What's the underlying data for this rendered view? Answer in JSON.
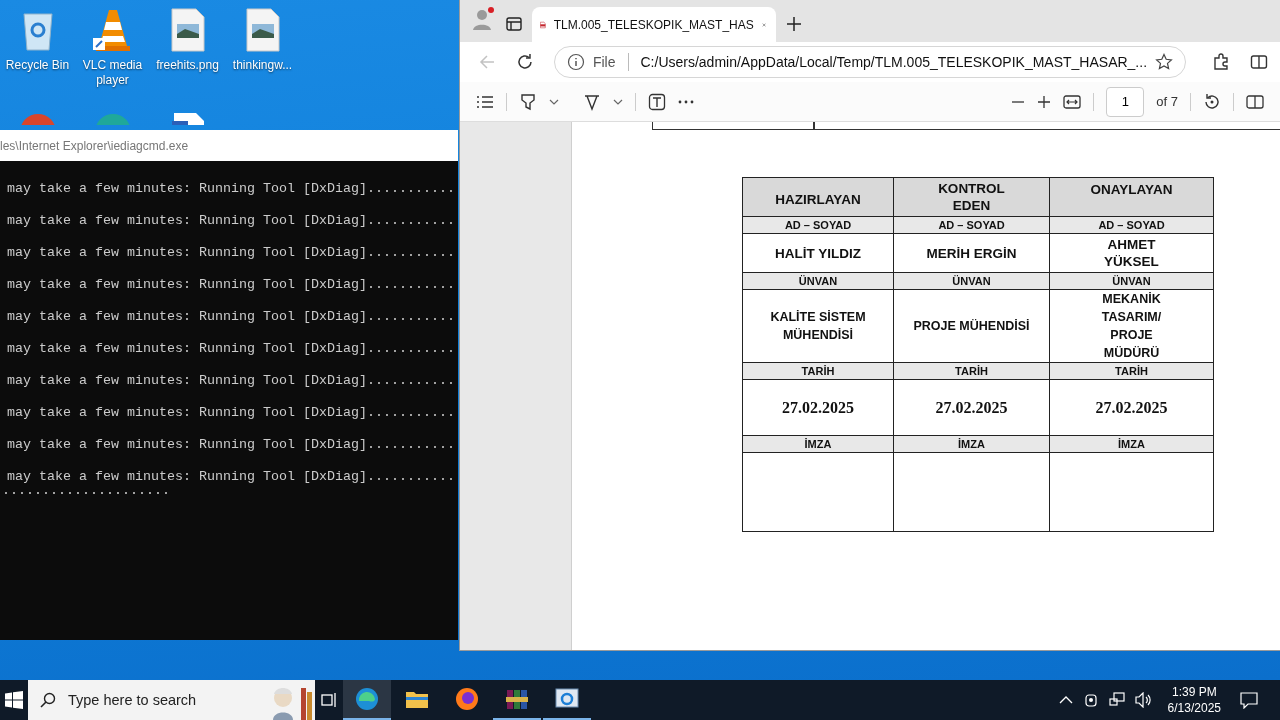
{
  "desktop_icons": [
    {
      "label": "Recycle Bin",
      "kind": "recycle"
    },
    {
      "label": "VLC media player",
      "kind": "vlc"
    },
    {
      "label": "freehits.png",
      "kind": "image"
    },
    {
      "label": "thinkingw...",
      "kind": "image"
    }
  ],
  "desktop_icons_row2": [
    {
      "kind": "browser-red"
    },
    {
      "kind": "browser-teal"
    },
    {
      "kind": "document"
    }
  ],
  "console": {
    "title": "les\\Internet Explorer\\iediagcmd.exe",
    "lines": [
      "may take a few minutes: Running Tool [DxDiag]...........",
      "may take a few minutes: Running Tool [DxDiag]...........",
      "may take a few minutes: Running Tool [DxDiag]...........",
      "may take a few minutes: Running Tool [DxDiag]...........",
      "may take a few minutes: Running Tool [DxDiag]...........",
      "may take a few minutes: Running Tool [DxDiag]...........",
      "may take a few minutes: Running Tool [DxDiag]...........",
      "may take a few minutes: Running Tool [DxDiag]...........",
      "may take a few minutes: Running Tool [DxDiag]...........",
      "may take a few minutes: Running Tool [DxDiag]...........",
      "....................."
    ]
  },
  "browser": {
    "tab": {
      "title": "TLM.005_TELESKOPIK_MAST_HAS",
      "selected": true
    },
    "address": {
      "scheme": "File",
      "url": "C:/Users/admin/AppData/Local/Temp/TLM.005_TELESKOPIK_MAST_HASAR_..."
    },
    "pdf_toolbar": {
      "page": "1",
      "page_count": "of 7"
    }
  },
  "table": {
    "headers": [
      "HAZIRLAYAN",
      "KONTROL\nEDEN",
      "ONAYLAYAN"
    ],
    "rows": [
      {
        "kind": "label",
        "cells": [
          "AD – SOYAD",
          "AD – SOYAD",
          "AD – SOYAD"
        ]
      },
      {
        "kind": "name",
        "cells": [
          "HALİT YILDIZ",
          "MERİH ERGİN",
          "AHMET\nYÜKSEL"
        ]
      },
      {
        "kind": "label",
        "cells": [
          "ÜNVAN",
          "ÜNVAN",
          "ÜNVAN"
        ]
      },
      {
        "kind": "title",
        "cells": [
          "KALİTE SİSTEM\nMÜHENDİSİ",
          "PROJE MÜHENDİSİ",
          "MEKANİK\nTASARIM/\nPROJE\nMÜDÜRÜ"
        ]
      },
      {
        "kind": "label",
        "cells": [
          "TARİH",
          "TARİH",
          "TARİH"
        ]
      },
      {
        "kind": "date",
        "cells": [
          "27.02.2025",
          "27.02.2025",
          "27.02.2025"
        ]
      },
      {
        "kind": "label",
        "cells": [
          "İMZA",
          "İMZA",
          "İMZA"
        ]
      }
    ]
  },
  "taskbar": {
    "search": {
      "placeholder": "Type here to search"
    },
    "apps": [
      {
        "kind": "edge",
        "selected": true,
        "running": true
      },
      {
        "kind": "explorer",
        "selected": false,
        "running": false
      },
      {
        "kind": "firefox",
        "selected": false,
        "running": false
      },
      {
        "kind": "winrar",
        "selected": false,
        "running": true
      },
      {
        "kind": "ie",
        "selected": false,
        "running": true
      }
    ],
    "time": "1:39 PM",
    "date": "6/13/2025"
  }
}
